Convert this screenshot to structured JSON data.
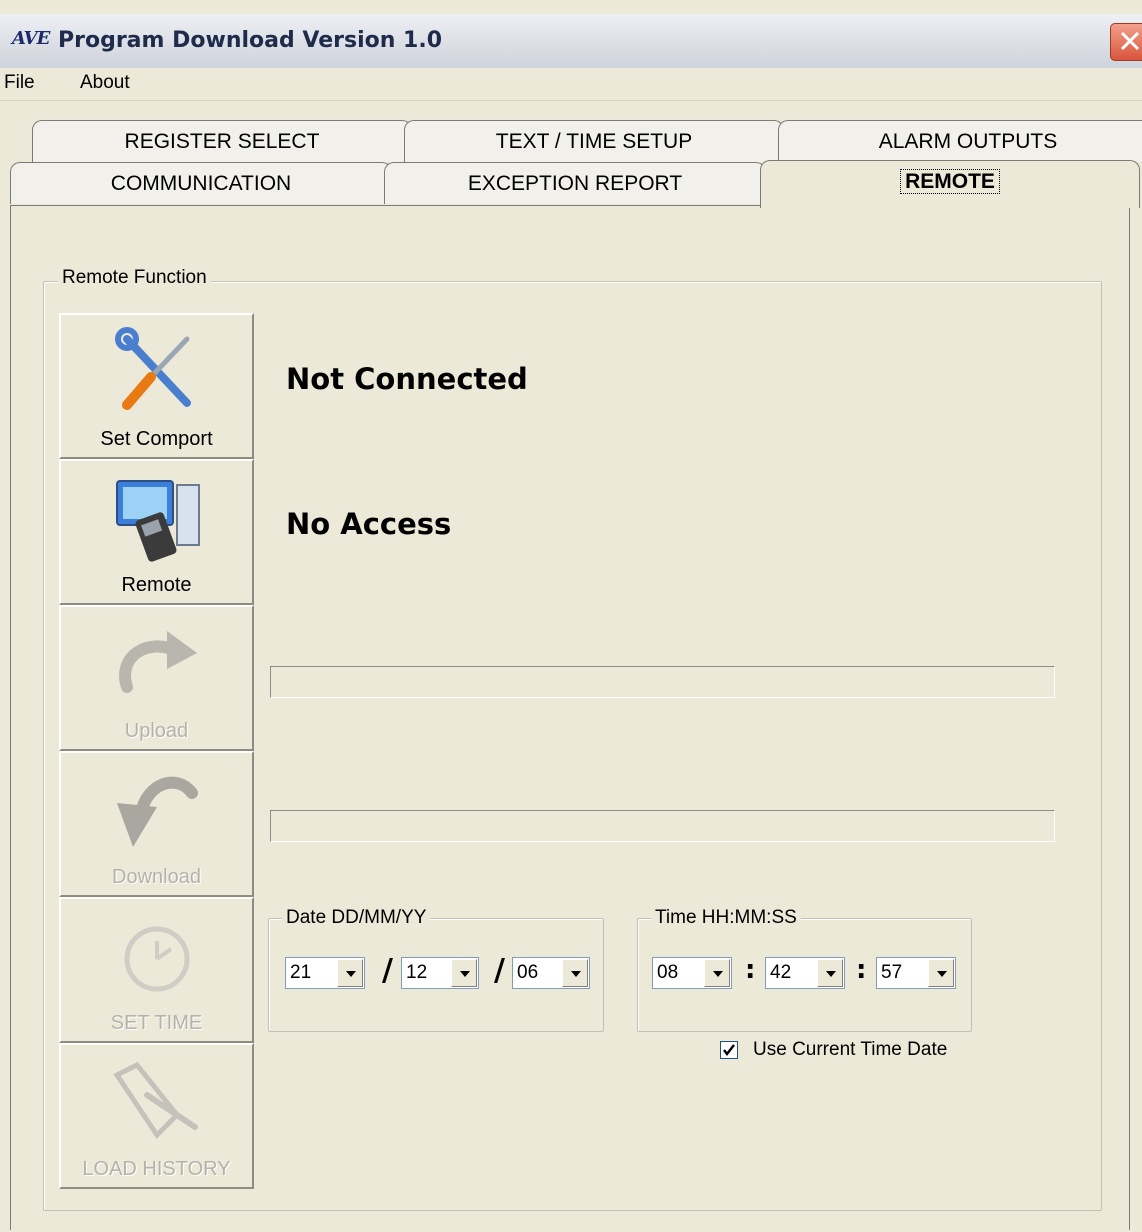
{
  "window": {
    "logo_text": "AVE",
    "title": "Program Download Version 1.0"
  },
  "menu": {
    "items": [
      {
        "label": "File"
      },
      {
        "label": "About"
      }
    ]
  },
  "tabs": {
    "row_back": [
      {
        "label": "REGISTER SELECT"
      },
      {
        "label": "TEXT / TIME SETUP"
      },
      {
        "label": "ALARM OUTPUTS"
      }
    ],
    "row_front": [
      {
        "label": "COMMUNICATION"
      },
      {
        "label": "EXCEPTION REPORT"
      },
      {
        "label": "REMOTE",
        "active": true
      }
    ]
  },
  "remote": {
    "group_label": "Remote Function",
    "buttons": [
      {
        "label": "Set Comport",
        "icon": "tools-icon",
        "enabled": true
      },
      {
        "label": "Remote",
        "icon": "computer-phone-icon",
        "enabled": true
      },
      {
        "label": "Upload",
        "icon": "upload-arrow-icon",
        "enabled": false
      },
      {
        "label": "Download",
        "icon": "download-arrow-icon",
        "enabled": false
      },
      {
        "label": "SET TIME",
        "icon": "clock-icon",
        "enabled": false
      },
      {
        "label": "LOAD HISTORY",
        "icon": "history-icon",
        "enabled": false
      }
    ],
    "connection_status": "Not Connected",
    "access_status": "No Access",
    "upload_progress": 0,
    "download_progress": 0,
    "date": {
      "label": "Date DD/MM/YY",
      "day": "21",
      "month": "12",
      "year": "06",
      "separator": "/"
    },
    "time": {
      "label": "Time HH:MM:SS",
      "hour": "08",
      "minute": "42",
      "second": "57",
      "separator": ":"
    },
    "use_current": {
      "label": "Use Current Time Date",
      "checked": true
    }
  }
}
